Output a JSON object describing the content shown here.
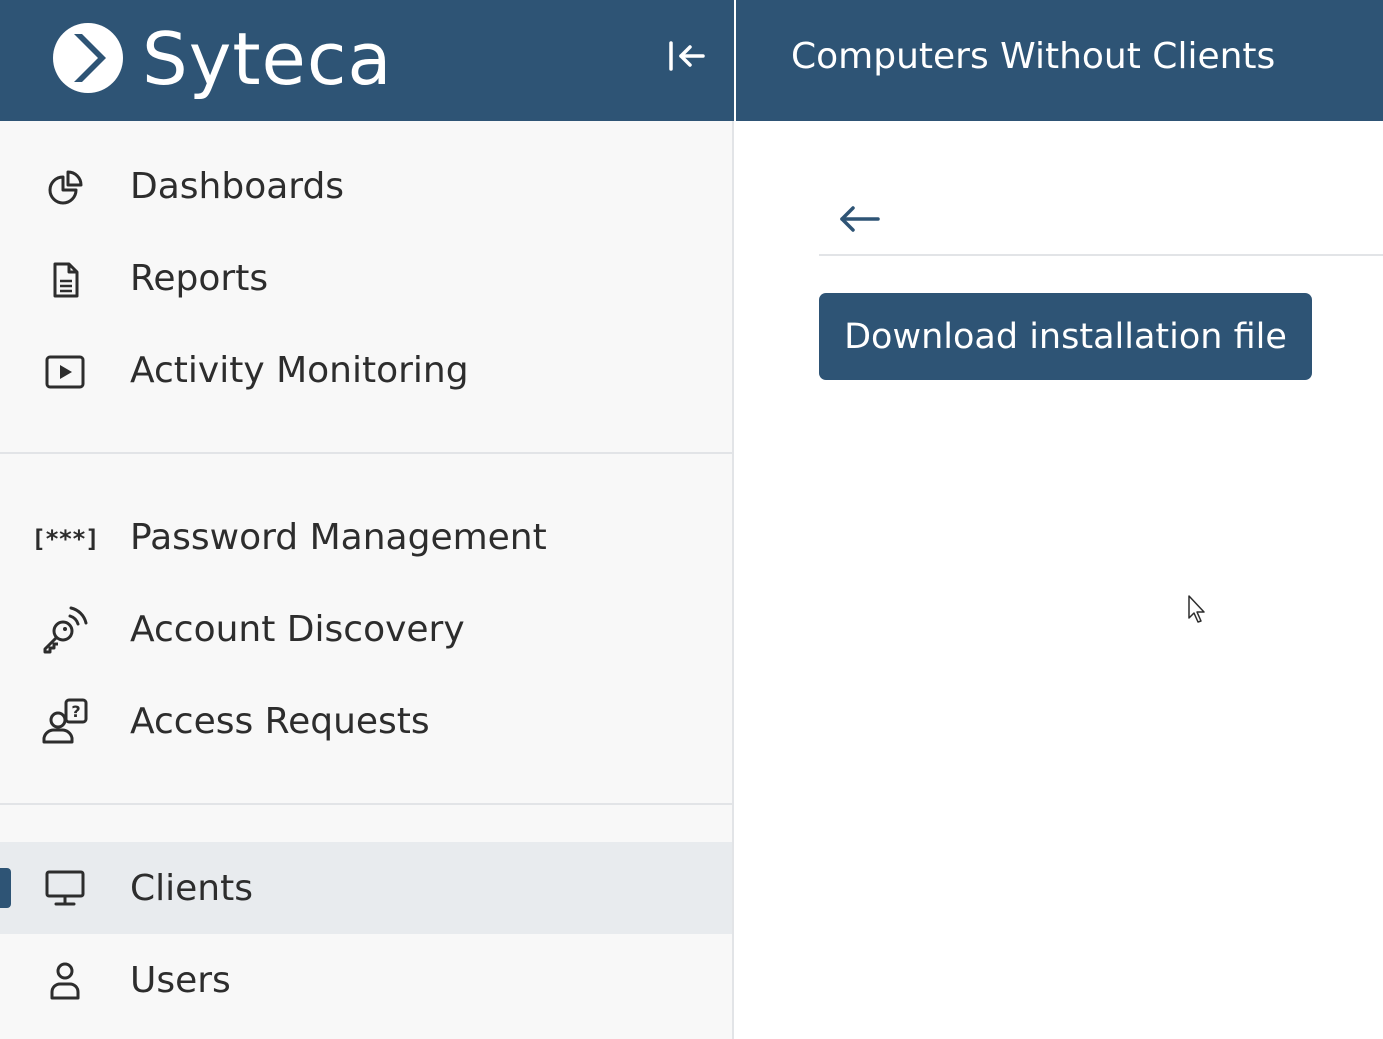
{
  "brand": {
    "name": "Syteca",
    "header_color": "#2e5475"
  },
  "sidebar": {
    "collapse_icon": "collapse-left-icon",
    "groups": [
      {
        "items": [
          {
            "label": "Dashboards",
            "icon": "pie-chart-icon"
          },
          {
            "label": "Reports",
            "icon": "document-icon"
          },
          {
            "label": "Activity Monitoring",
            "icon": "play-screen-icon"
          }
        ]
      },
      {
        "items": [
          {
            "label": "Password Management",
            "icon": "password-brackets-icon"
          },
          {
            "label": "Account Discovery",
            "icon": "key-signal-icon"
          },
          {
            "label": "Access Requests",
            "icon": "user-question-icon"
          }
        ]
      },
      {
        "items": [
          {
            "label": "Clients",
            "icon": "monitor-icon",
            "active": true
          },
          {
            "label": "Users",
            "icon": "user-icon"
          }
        ]
      }
    ]
  },
  "main": {
    "title": "Computers Without Clients",
    "back_icon": "arrow-left-icon",
    "download_label": "Download installation file"
  },
  "password_icon_text": "[***]"
}
